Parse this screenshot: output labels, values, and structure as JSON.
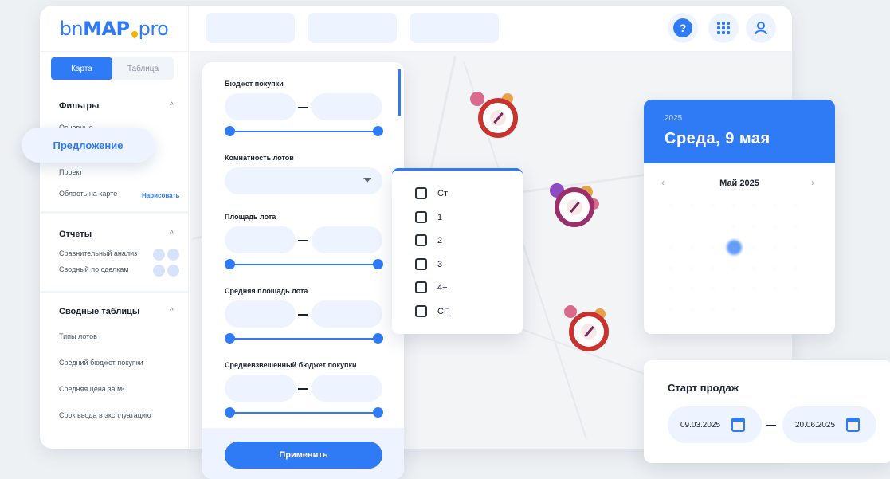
{
  "brand": {
    "logo_pre": "bn",
    "logo_mid": "MAP",
    "logo_post": "pro"
  },
  "header": {
    "help_label": "?"
  },
  "sidebar": {
    "view_tabs": [
      "Карта",
      "Таблица"
    ],
    "filters_title": "Фильтры",
    "filter_items": [
      "Основные",
      "Проект",
      "Область на карте"
    ],
    "draw_link": "Нарисовать",
    "reports_title": "Отчеты",
    "report_items": [
      "Сравнительный анализ",
      "Сводный по сделкам"
    ],
    "pivot_title": "Сводные таблицы",
    "pivot_items": [
      "Типы лотов",
      "Средний бюджет покупки",
      "Средняя цена за м².",
      "Срок ввода в эксплуатацию"
    ]
  },
  "active_chip": "Предложение",
  "filters_panel": {
    "budget_label": "Бюджет покупки",
    "rooms_label": "Комнатность лотов",
    "area_label": "Площадь лота",
    "avg_area_label": "Средняя площадь лота",
    "weighted_budget_label": "Средневзвешенный бюджет покупки",
    "apply_button": "Применить"
  },
  "rooms_dropdown": {
    "options": [
      "Ст",
      "1",
      "2",
      "3",
      "4+",
      "СП"
    ]
  },
  "calendar": {
    "year": "2025",
    "date_title": "Среда, 9 мая",
    "month_title": "Май 2025"
  },
  "sales_start": {
    "title": "Старт продаж",
    "date_from": "09.03.2025",
    "date_to": "20.06.2025"
  },
  "colors": {
    "accent": "#2f7bf5",
    "light": "#eef4ff",
    "marker": "#c8332f"
  }
}
